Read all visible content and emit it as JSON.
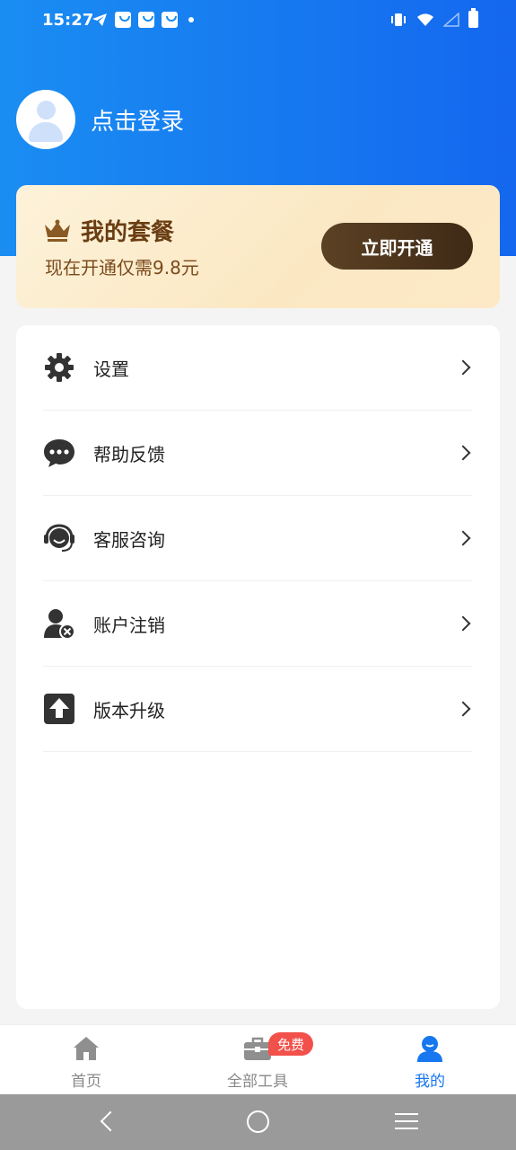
{
  "status_bar": {
    "time": "15:27"
  },
  "profile": {
    "login_text": "点击登录"
  },
  "vip": {
    "title": "我的套餐",
    "subtitle": "现在开通仅需9.8元",
    "button": "立即开通"
  },
  "menu": {
    "items": [
      {
        "label": "设置",
        "icon": "gear-icon"
      },
      {
        "label": "帮助反馈",
        "icon": "chat-bubble-icon"
      },
      {
        "label": "客服咨询",
        "icon": "headset-icon"
      },
      {
        "label": "账户注销",
        "icon": "user-remove-icon"
      },
      {
        "label": "版本升级",
        "icon": "upgrade-arrow-icon"
      }
    ]
  },
  "tabbar": {
    "tabs": [
      {
        "label": "首页",
        "icon": "home-icon",
        "active": false
      },
      {
        "label": "全部工具",
        "icon": "toolbox-icon",
        "active": false,
        "badge": "免费"
      },
      {
        "label": "我的",
        "icon": "user-icon",
        "active": true
      }
    ]
  },
  "colors": {
    "primary": "#1677f0",
    "vip_text": "#6a3d13",
    "badge": "#f2504b"
  }
}
